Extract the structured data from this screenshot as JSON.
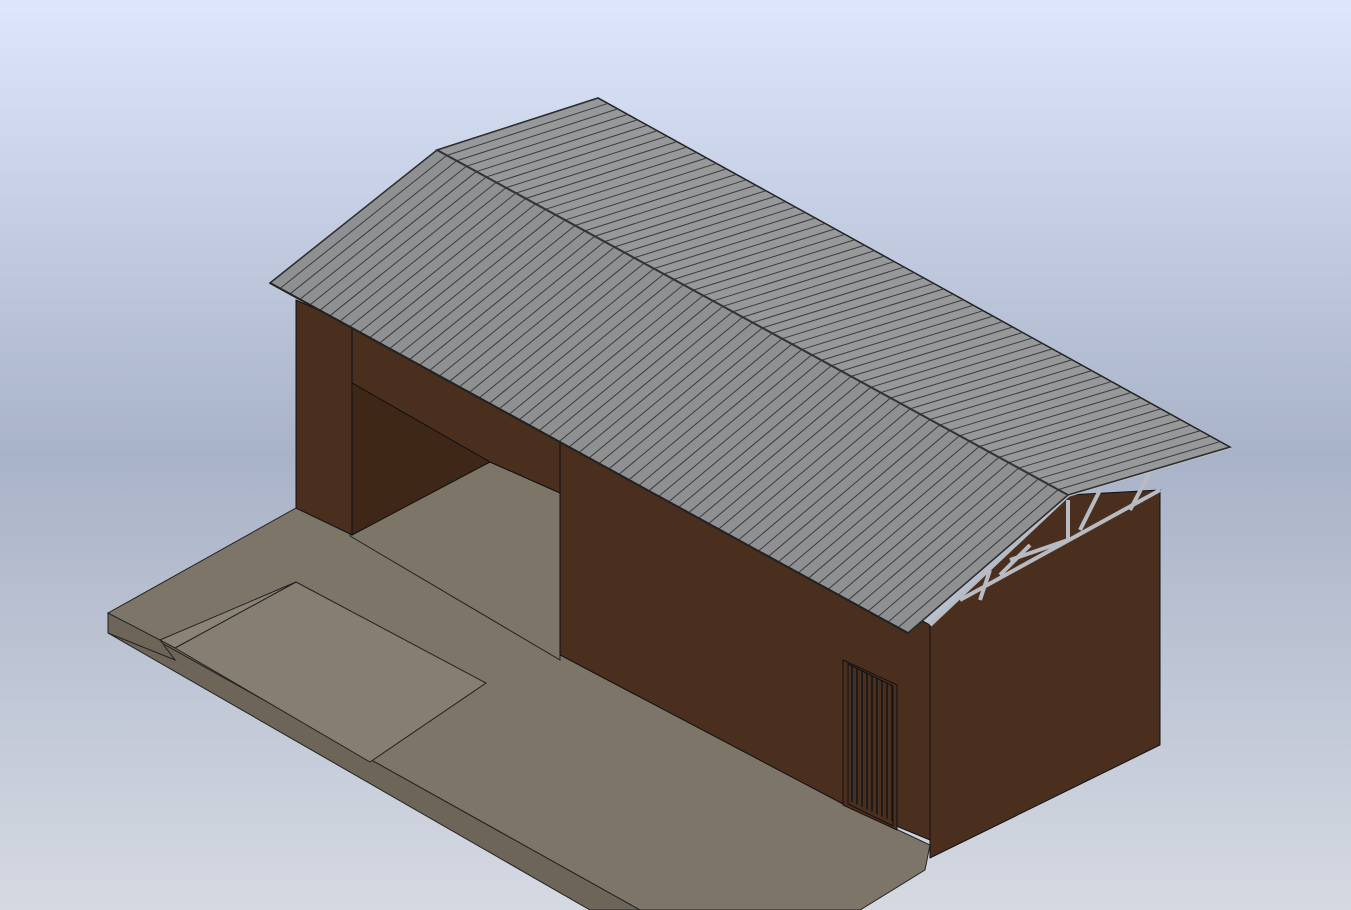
{
  "viewport": {
    "background": {
      "top": "#dde6fb",
      "middle": "#a9b3c8",
      "bottom": "#d5d9e2"
    },
    "model": {
      "name": "shed-with-ramp",
      "view": "isometric"
    },
    "colors": {
      "wall": "#4a2e1e",
      "wall_dark": "#3f2718",
      "floor": "#7d7567",
      "floor_side": "#6c6558",
      "ramp": "#857e71",
      "roof": "#8f9092",
      "roof_rib": "#3a3b3d",
      "truss": "#b8bcc2",
      "door_bars": "#1c1c1c"
    }
  }
}
